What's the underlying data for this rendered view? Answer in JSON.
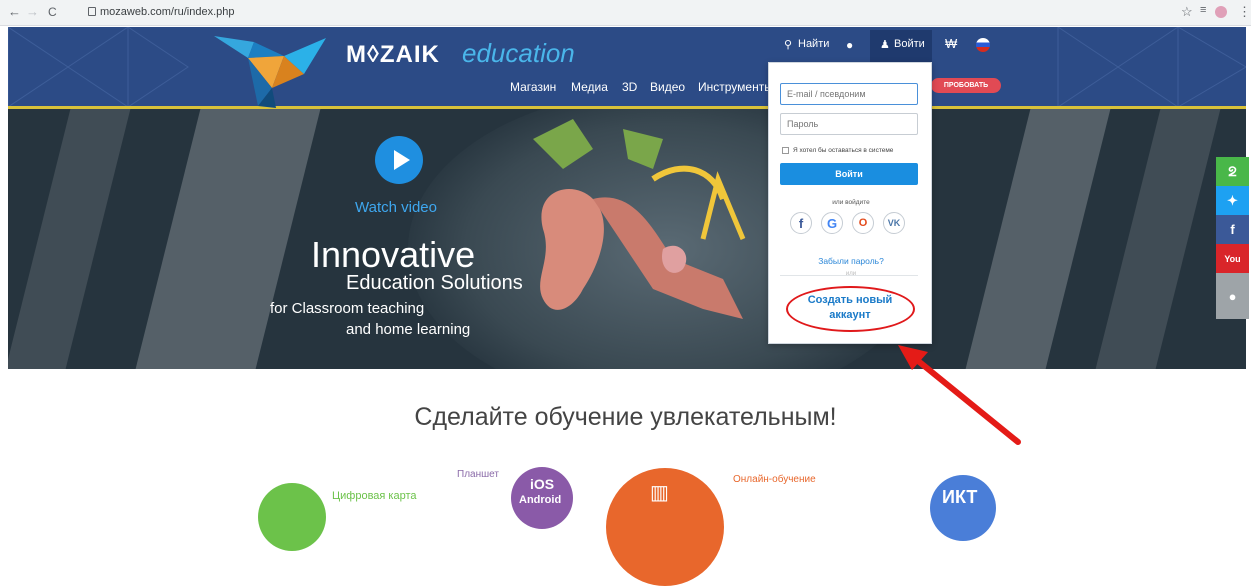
{
  "browser": {
    "back": "←",
    "forward": "→",
    "reload": "C",
    "url": "mozaweb.com/ru/index.php",
    "star": "☆",
    "menu": "⋮"
  },
  "header": {
    "logo": "M◊ZAIK",
    "logo_sub": "education",
    "top_nav": {
      "search": "Найти",
      "login": "Войти",
      "cart_icon": "cart-icon"
    },
    "main_nav": [
      "Магазин",
      "Медиа",
      "3D",
      "Видео",
      "Инструменты"
    ],
    "try_button": "ПРОБОВАТЬ",
    "brand_color": "#2c4b86"
  },
  "hero": {
    "watch_video": "Watch video",
    "title": "Innovative",
    "subtitle": "Education Solutions",
    "line1": "for Classroom teaching",
    "line2": "and home learning"
  },
  "login_form": {
    "email_placeholder": "E-mail / псевдоним",
    "password_placeholder": "Пароль",
    "remember": "Я хотел бы оставаться в системе",
    "login_button": "Войти",
    "or_login_with": "или войдите",
    "social": [
      "f",
      "G",
      "O",
      "VK"
    ],
    "forgot": "Забыли пароль?",
    "or": "или",
    "create_account_line1": "Создать новый",
    "create_account_line2": "аккаунт",
    "accent": "#1a8ee0"
  },
  "sidebar": [
    {
      "icon": "rss-icon",
      "glyph": "ᘖ",
      "color": "#49b749"
    },
    {
      "icon": "twitter-icon",
      "glyph": "✦",
      "color": "#1da1f2"
    },
    {
      "icon": "facebook-icon",
      "glyph": "f",
      "color": "#3b5998"
    },
    {
      "icon": "youtube-icon",
      "glyph": "▶",
      "color": "#d9252a"
    },
    {
      "icon": "chat-icon",
      "glyph": "?",
      "color": "#9ea4a8"
    }
  ],
  "section": {
    "tagline": "Сделайте обучение увлекательным!",
    "digital_map": "Цифровая карта",
    "tablet": "Планшет",
    "ios": "iOS",
    "android": "Android",
    "online": "Онлайн-обучение",
    "ikt": "ИКТ"
  }
}
